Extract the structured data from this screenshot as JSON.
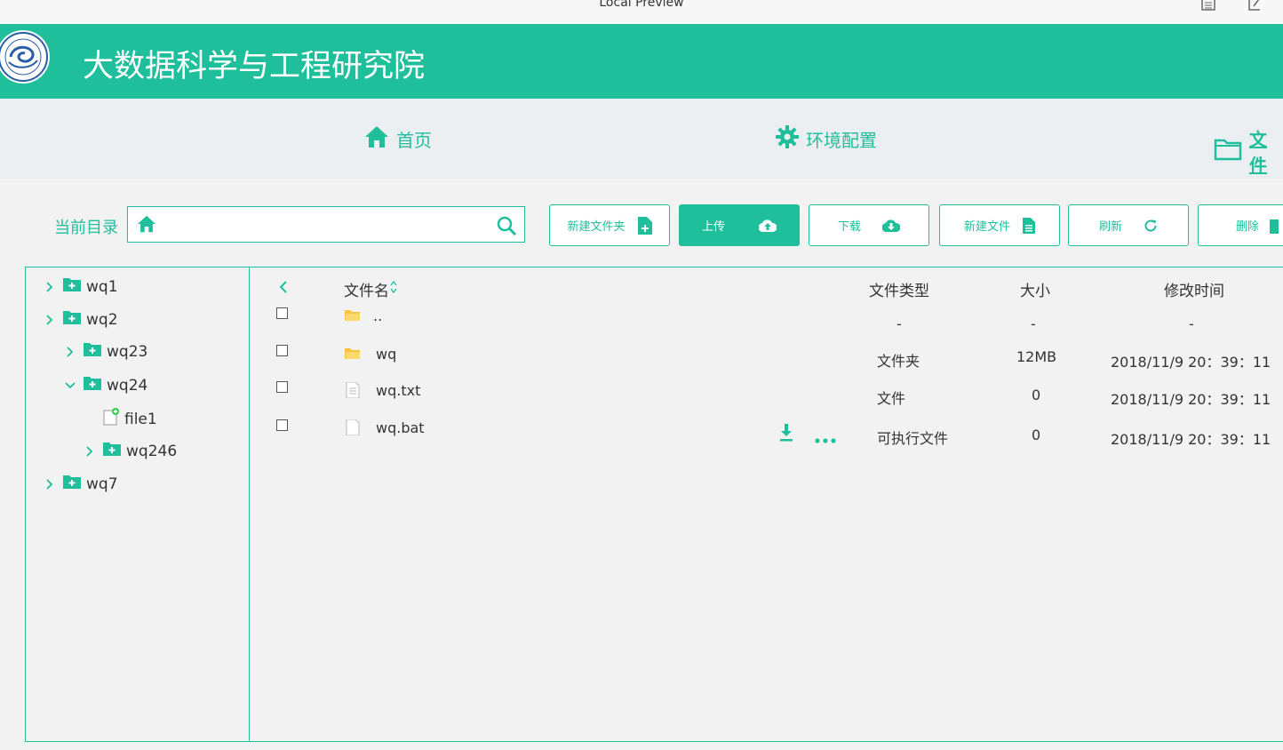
{
  "window": {
    "title": "Local Preview"
  },
  "header": {
    "site_title": "大数据科学与工程研究院"
  },
  "nav": {
    "items": [
      {
        "label": "首页",
        "icon": "home-icon"
      },
      {
        "label": "环境配置",
        "icon": "gear-icon"
      },
      {
        "label": "文件",
        "icon": "folder-icon"
      }
    ]
  },
  "toolbar": {
    "current_dir_label": "当前目录",
    "path_value": "",
    "buttons": {
      "new_folder": "新建文件夹",
      "upload": "上传",
      "download": "下载",
      "new_file": "新建文件",
      "refresh": "刷新",
      "delete": "删除"
    }
  },
  "tree": {
    "nodes": [
      {
        "label": "wq1"
      },
      {
        "label": "wq2"
      },
      {
        "label": "wq23"
      },
      {
        "label": "wq24"
      },
      {
        "label": "file1"
      },
      {
        "label": "wq246"
      },
      {
        "label": "wq7"
      }
    ]
  },
  "file_table": {
    "columns": {
      "name": "文件名",
      "type": "文件类型",
      "size": "大小",
      "modified": "修改时间"
    },
    "rows": [
      {
        "name": "..",
        "type": "-",
        "size": "-",
        "modified": "-"
      },
      {
        "name": "wq",
        "type": "文件夹",
        "size": "12MB",
        "modified": "2018/11/9 20：39：11"
      },
      {
        "name": "wq.txt",
        "type": "文件",
        "size": "0",
        "modified": "2018/11/9 20：39：11"
      },
      {
        "name": "wq.bat",
        "type": "可执行文件",
        "size": "0",
        "modified": "2018/11/9 20：39：11"
      }
    ]
  },
  "colors": {
    "accent": "#1fbf9c",
    "nav_bg": "#eceff1",
    "page_bg": "#f2f2f2"
  }
}
